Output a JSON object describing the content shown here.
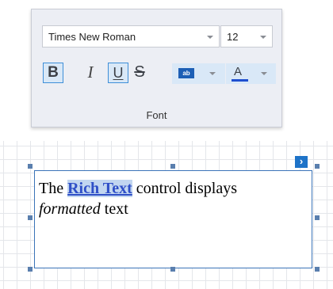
{
  "font_group": {
    "caption": "Font",
    "font_family": {
      "value": "Times New Roman"
    },
    "font_size": {
      "value": "12"
    },
    "buttons": {
      "bold": {
        "glyph": "B",
        "pressed": true
      },
      "italic": {
        "glyph": "I",
        "pressed": false
      },
      "underline": {
        "glyph": "U",
        "pressed": true
      },
      "strikethrough": {
        "glyph": "S",
        "pressed": false
      }
    },
    "highlight": {
      "icon_text": "ab",
      "color": "#1d5fb5"
    },
    "font_color": {
      "glyph": "A",
      "color": "#1f4fcf"
    }
  },
  "rich_text": {
    "line1_prefix": "The ",
    "line1_link": "Rich Text",
    "line1_suffix": " control displays",
    "line2_italic": "formatted",
    "line2_suffix": " text"
  },
  "smart_tag": {
    "glyph": "›"
  },
  "colors": {
    "selection_border": "#3b74b8",
    "active_button_border": "#3e8ed8",
    "link_text": "#2f4fc7"
  }
}
